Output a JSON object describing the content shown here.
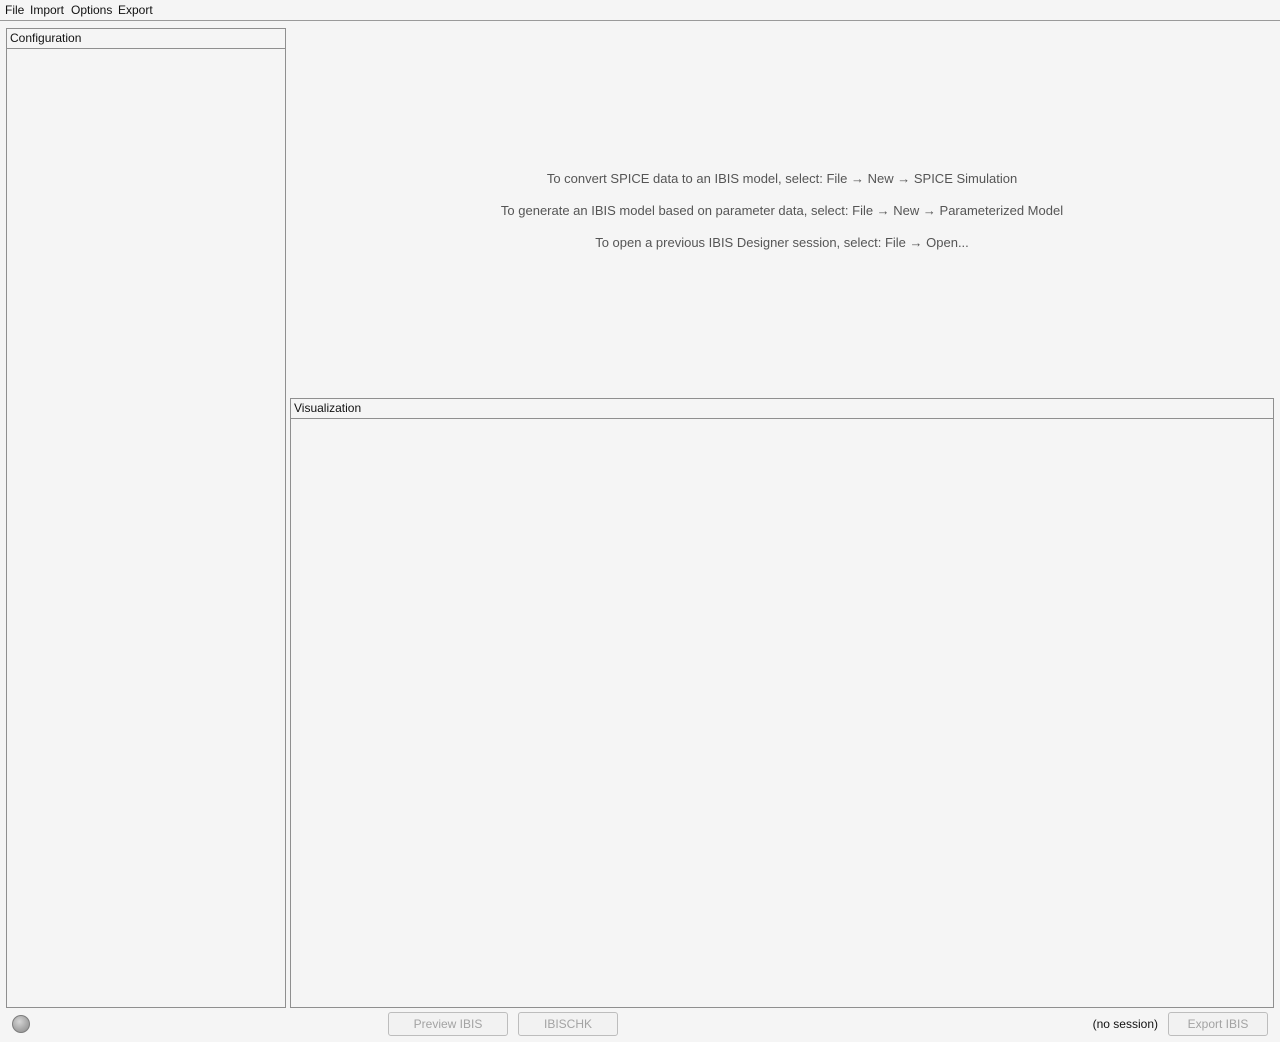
{
  "menubar": {
    "items": [
      "File",
      "Import",
      "Options",
      "Export"
    ]
  },
  "panels": {
    "configuration": {
      "title": "Configuration"
    },
    "visualization": {
      "title": "Visualization"
    }
  },
  "instructions": [
    "To convert SPICE data to an IBIS model, select: File → New → SPICE Simulation",
    "To generate an IBIS model based on parameter data, select: File → New → Parameterized Model",
    "To open a previous IBIS Designer session, select: File → Open..."
  ],
  "footer": {
    "preview_label": "Preview IBIS",
    "ibischk_label": "IBISCHK",
    "session_status": "(no session)",
    "export_label": "Export IBIS",
    "status_indicator_color": "#a9a9a9"
  }
}
